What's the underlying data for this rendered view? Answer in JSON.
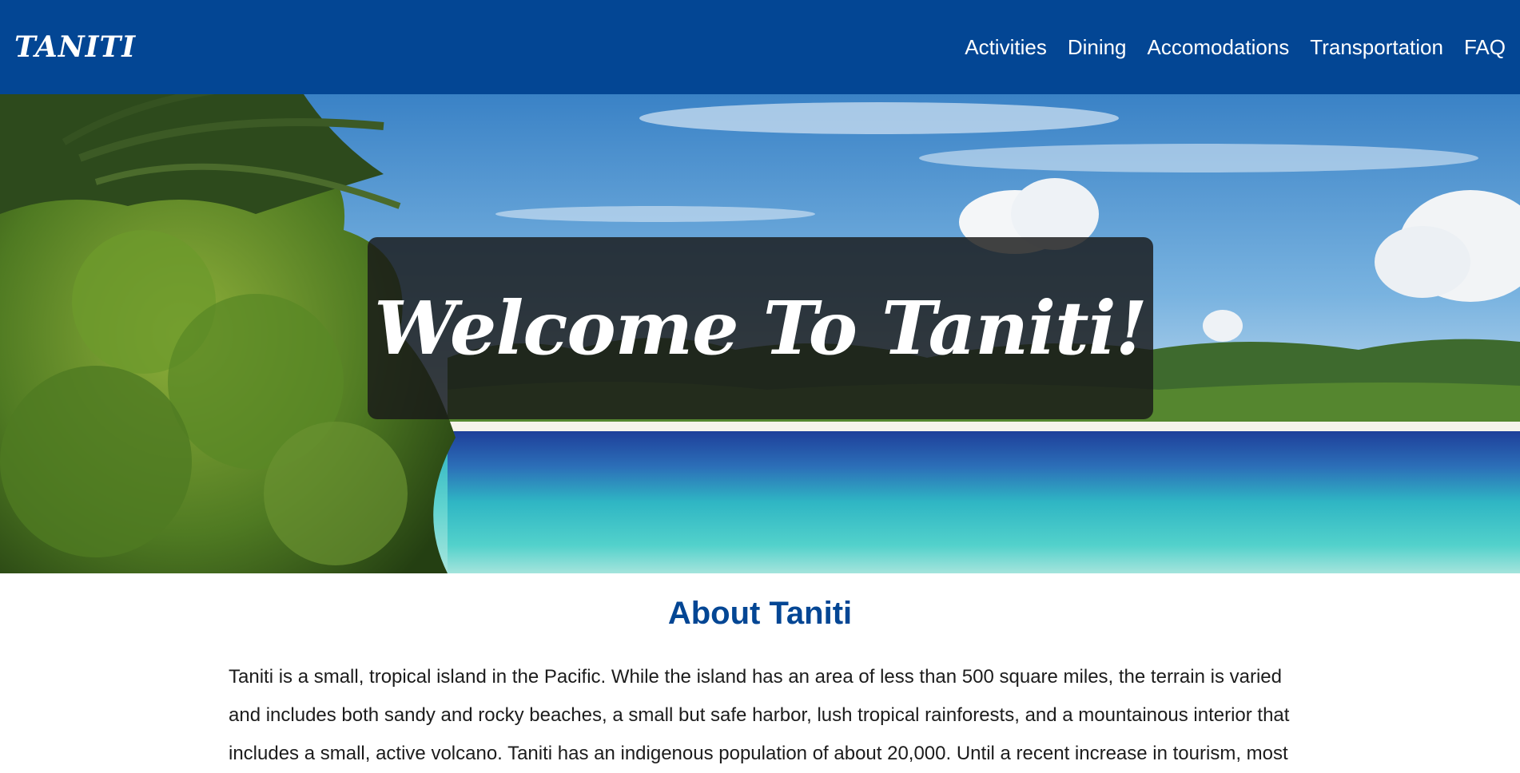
{
  "navbar": {
    "brand": "TANITI",
    "links": [
      "Activities",
      "Dining",
      "Accomodations",
      "Transportation",
      "FAQ"
    ]
  },
  "hero": {
    "heading": "Welcome To Taniti!"
  },
  "about": {
    "title": "About Taniti",
    "body": "Taniti is a small, tropical island in the Pacific. While the island has an area of less than 500 square miles, the terrain is varied and includes both sandy and rocky beaches, a small but safe harbor, lush tropical rainforests, and a mountainous interior that includes a small, active volcano. Taniti has an indigenous population of about 20,000. Until a recent increase in tourism, most"
  },
  "colors": {
    "navbar_bg": "#034694",
    "accent": "#034694",
    "text": "#1c1c1c"
  }
}
